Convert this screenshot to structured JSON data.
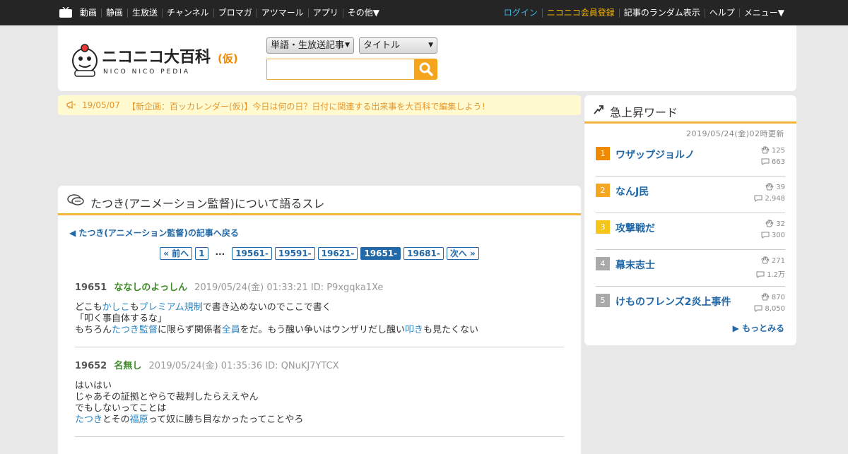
{
  "topbar": {
    "nav": [
      "動画",
      "静画",
      "生放送",
      "チャンネル",
      "ブロマガ",
      "アツマール",
      "アプリ",
      "その他▼"
    ],
    "right": {
      "login": "ログイン",
      "register": "ニコニコ会員登録",
      "random": "記事のランダム表示",
      "help": "ヘルプ",
      "menu": "メニュー▼"
    }
  },
  "header": {
    "logo_text": "ニコニコ大百科",
    "logo_suffix": "(仮)",
    "logo_sub": "NICO NICO PEDIA",
    "category_select": "単語・生放送記事",
    "field_select": "タイトル",
    "search_value": ""
  },
  "notice": {
    "date": "19/05/07",
    "message": "【新企画：百ッカレンダー(仮)】今日は何の日？日付に関連する出来事を大百科で編集しよう！"
  },
  "thread": {
    "title": "たつき(アニメーション監督)について語るスレ",
    "back_link": "たつき(アニメーション監督)の記事へ戻る",
    "pager": {
      "prev": "« 前へ",
      "first": "1",
      "dots": "...",
      "pages": [
        "19561-",
        "19591-",
        "19621-",
        "19651-",
        "19681-"
      ],
      "current": "19651-",
      "next": "次へ »"
    },
    "responses": [
      {
        "num": "19651",
        "name": "ななしのよっしん",
        "info": "2019/05/24(金) 01:33:21 ID: P9xgqka1Xe",
        "lines": [
          [
            {
              "t": "どこも"
            },
            {
              "t": "かしこ",
              "k": true
            },
            {
              "t": "も"
            },
            {
              "t": "プレミアム規制",
              "k": true
            },
            {
              "t": "で書き込めないのでここで書く"
            }
          ],
          [
            {
              "t": "「叩く事自体するな」"
            }
          ],
          [
            {
              "t": "もちろん"
            },
            {
              "t": "たつき監督",
              "k": true
            },
            {
              "t": "に限らず関係者"
            },
            {
              "t": "全員",
              "k": true
            },
            {
              "t": "をだ。もう醜い争いはウンザリだし醜い"
            },
            {
              "t": "叩き",
              "k": true
            },
            {
              "t": "も見たくない"
            }
          ]
        ]
      },
      {
        "num": "19652",
        "name": "名無し",
        "info": "2019/05/24(金) 01:35:36 ID: QNuKJ7YTCX",
        "lines": [
          [
            {
              "t": "はいはい"
            }
          ],
          [
            {
              "t": "じゃあその証拠とやらで裁判したらええやん"
            }
          ],
          [
            {
              "t": "でもしないってことは"
            }
          ],
          [
            {
              "t": "たつき",
              "k": true
            },
            {
              "t": "とその"
            },
            {
              "t": "福原",
              "k": true
            },
            {
              "t": "って奴に勝ち目なかったってことやろ"
            }
          ]
        ]
      }
    ]
  },
  "trend": {
    "title": "急上昇ワード",
    "updated": "2019/05/24(金)02時更新",
    "items": [
      {
        "rank": "1",
        "word": "ワザップジョルノ",
        "hands": "125",
        "comments": "663",
        "color": "#f08a00"
      },
      {
        "rank": "2",
        "word": "なんJ民",
        "hands": "39",
        "comments": "2,948",
        "color": "#f5a623"
      },
      {
        "rank": "3",
        "word": "攻撃戦だ",
        "hands": "32",
        "comments": "300",
        "color": "#f5c518"
      },
      {
        "rank": "4",
        "word": "幕末志士",
        "hands": "271",
        "comments": "1.2万",
        "color": "#aaaaaa"
      },
      {
        "rank": "5",
        "word": "けものフレンズ2炎上事件",
        "hands": "870",
        "comments": "8,050",
        "color": "#aaaaaa"
      }
    ],
    "more": "もっとみる"
  },
  "colors": {
    "accent": "#f4b43a",
    "link": "#2068a8",
    "keyword": "#2a86c8",
    "name": "#3d8a26",
    "topbar": "#252525"
  }
}
